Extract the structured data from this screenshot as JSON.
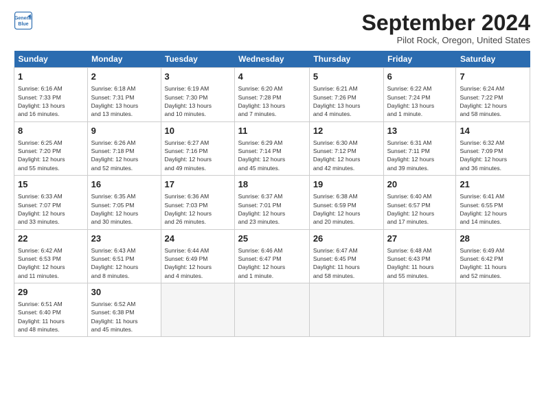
{
  "header": {
    "logo_line1": "General",
    "logo_line2": "Blue",
    "month": "September 2024",
    "location": "Pilot Rock, Oregon, United States"
  },
  "weekdays": [
    "Sunday",
    "Monday",
    "Tuesday",
    "Wednesday",
    "Thursday",
    "Friday",
    "Saturday"
  ],
  "weeks": [
    [
      {
        "day": "1",
        "info": "Sunrise: 6:16 AM\nSunset: 7:33 PM\nDaylight: 13 hours\nand 16 minutes."
      },
      {
        "day": "2",
        "info": "Sunrise: 6:18 AM\nSunset: 7:31 PM\nDaylight: 13 hours\nand 13 minutes."
      },
      {
        "day": "3",
        "info": "Sunrise: 6:19 AM\nSunset: 7:30 PM\nDaylight: 13 hours\nand 10 minutes."
      },
      {
        "day": "4",
        "info": "Sunrise: 6:20 AM\nSunset: 7:28 PM\nDaylight: 13 hours\nand 7 minutes."
      },
      {
        "day": "5",
        "info": "Sunrise: 6:21 AM\nSunset: 7:26 PM\nDaylight: 13 hours\nand 4 minutes."
      },
      {
        "day": "6",
        "info": "Sunrise: 6:22 AM\nSunset: 7:24 PM\nDaylight: 13 hours\nand 1 minute."
      },
      {
        "day": "7",
        "info": "Sunrise: 6:24 AM\nSunset: 7:22 PM\nDaylight: 12 hours\nand 58 minutes."
      }
    ],
    [
      {
        "day": "8",
        "info": "Sunrise: 6:25 AM\nSunset: 7:20 PM\nDaylight: 12 hours\nand 55 minutes."
      },
      {
        "day": "9",
        "info": "Sunrise: 6:26 AM\nSunset: 7:18 PM\nDaylight: 12 hours\nand 52 minutes."
      },
      {
        "day": "10",
        "info": "Sunrise: 6:27 AM\nSunset: 7:16 PM\nDaylight: 12 hours\nand 49 minutes."
      },
      {
        "day": "11",
        "info": "Sunrise: 6:29 AM\nSunset: 7:14 PM\nDaylight: 12 hours\nand 45 minutes."
      },
      {
        "day": "12",
        "info": "Sunrise: 6:30 AM\nSunset: 7:12 PM\nDaylight: 12 hours\nand 42 minutes."
      },
      {
        "day": "13",
        "info": "Sunrise: 6:31 AM\nSunset: 7:11 PM\nDaylight: 12 hours\nand 39 minutes."
      },
      {
        "day": "14",
        "info": "Sunrise: 6:32 AM\nSunset: 7:09 PM\nDaylight: 12 hours\nand 36 minutes."
      }
    ],
    [
      {
        "day": "15",
        "info": "Sunrise: 6:33 AM\nSunset: 7:07 PM\nDaylight: 12 hours\nand 33 minutes."
      },
      {
        "day": "16",
        "info": "Sunrise: 6:35 AM\nSunset: 7:05 PM\nDaylight: 12 hours\nand 30 minutes."
      },
      {
        "day": "17",
        "info": "Sunrise: 6:36 AM\nSunset: 7:03 PM\nDaylight: 12 hours\nand 26 minutes."
      },
      {
        "day": "18",
        "info": "Sunrise: 6:37 AM\nSunset: 7:01 PM\nDaylight: 12 hours\nand 23 minutes."
      },
      {
        "day": "19",
        "info": "Sunrise: 6:38 AM\nSunset: 6:59 PM\nDaylight: 12 hours\nand 20 minutes."
      },
      {
        "day": "20",
        "info": "Sunrise: 6:40 AM\nSunset: 6:57 PM\nDaylight: 12 hours\nand 17 minutes."
      },
      {
        "day": "21",
        "info": "Sunrise: 6:41 AM\nSunset: 6:55 PM\nDaylight: 12 hours\nand 14 minutes."
      }
    ],
    [
      {
        "day": "22",
        "info": "Sunrise: 6:42 AM\nSunset: 6:53 PM\nDaylight: 12 hours\nand 11 minutes."
      },
      {
        "day": "23",
        "info": "Sunrise: 6:43 AM\nSunset: 6:51 PM\nDaylight: 12 hours\nand 8 minutes."
      },
      {
        "day": "24",
        "info": "Sunrise: 6:44 AM\nSunset: 6:49 PM\nDaylight: 12 hours\nand 4 minutes."
      },
      {
        "day": "25",
        "info": "Sunrise: 6:46 AM\nSunset: 6:47 PM\nDaylight: 12 hours\nand 1 minute."
      },
      {
        "day": "26",
        "info": "Sunrise: 6:47 AM\nSunset: 6:45 PM\nDaylight: 11 hours\nand 58 minutes."
      },
      {
        "day": "27",
        "info": "Sunrise: 6:48 AM\nSunset: 6:43 PM\nDaylight: 11 hours\nand 55 minutes."
      },
      {
        "day": "28",
        "info": "Sunrise: 6:49 AM\nSunset: 6:42 PM\nDaylight: 11 hours\nand 52 minutes."
      }
    ],
    [
      {
        "day": "29",
        "info": "Sunrise: 6:51 AM\nSunset: 6:40 PM\nDaylight: 11 hours\nand 48 minutes."
      },
      {
        "day": "30",
        "info": "Sunrise: 6:52 AM\nSunset: 6:38 PM\nDaylight: 11 hours\nand 45 minutes."
      },
      {
        "day": "",
        "info": ""
      },
      {
        "day": "",
        "info": ""
      },
      {
        "day": "",
        "info": ""
      },
      {
        "day": "",
        "info": ""
      },
      {
        "day": "",
        "info": ""
      }
    ]
  ]
}
